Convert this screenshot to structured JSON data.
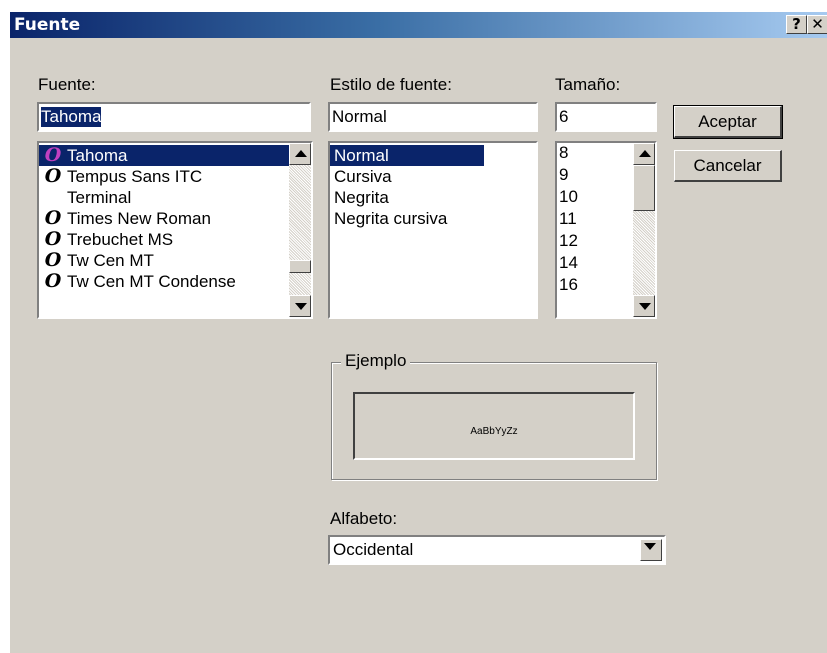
{
  "window": {
    "title": "Fuente",
    "help_label": "?",
    "close_label": "✕"
  },
  "font": {
    "label": "Fuente:",
    "value": "Tahoma",
    "items": [
      {
        "name": "Tahoma",
        "icon": "opentype-icon",
        "selected": true
      },
      {
        "name": "Tempus Sans ITC",
        "icon": "opentype-icon"
      },
      {
        "name": "Terminal",
        "icon": "none"
      },
      {
        "name": "Times New Roman",
        "icon": "opentype-icon"
      },
      {
        "name": "Trebuchet MS",
        "icon": "opentype-icon"
      },
      {
        "name": "Tw Cen MT",
        "icon": "opentype-icon"
      },
      {
        "name": "Tw Cen MT Condense",
        "icon": "opentype-icon"
      }
    ]
  },
  "style": {
    "label": "Estilo de fuente:",
    "value": "Normal",
    "items": [
      {
        "name": "Normal",
        "selected": true
      },
      {
        "name": "Cursiva"
      },
      {
        "name": "Negrita"
      },
      {
        "name": "Negrita cursiva"
      }
    ]
  },
  "size": {
    "label": "Tamaño:",
    "value": "6",
    "items": [
      "8",
      "9",
      "10",
      "11",
      "12",
      "14",
      "16"
    ]
  },
  "buttons": {
    "ok": "Aceptar",
    "cancel": "Cancelar"
  },
  "sample": {
    "label": "Ejemplo",
    "text": "AaBbYyZz"
  },
  "script": {
    "label": "Alfabeto:",
    "value": "Occidental"
  },
  "colors": {
    "titlebar_start": "#0a246a",
    "titlebar_end": "#a6caf0",
    "face": "#d4d0c8",
    "selection": "#0a246a",
    "font_icon_tahoma": "#c040c0"
  }
}
